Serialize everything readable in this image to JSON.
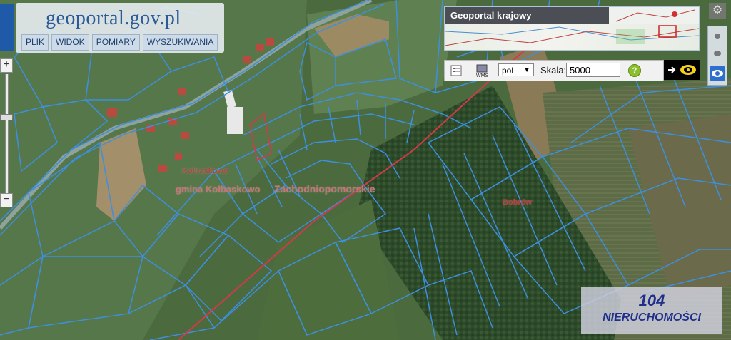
{
  "header": {
    "logo_text": "geoportal.gov.pl"
  },
  "menu": [
    {
      "label": "PLIK"
    },
    {
      "label": "WIDOK"
    },
    {
      "label": "POMIARY"
    },
    {
      "label": "WYSZUKIWANIA"
    }
  ],
  "zoom": {
    "in_symbol": "+",
    "out_symbol": "−",
    "level_fraction": 0.35
  },
  "overview": {
    "title": "Geoportal krajowy"
  },
  "toolbar": {
    "language_value": "pol",
    "scale_label": "Skala:",
    "scale_value": "5000",
    "help_symbol": "?",
    "icons": [
      "legend-icon",
      "wms-icon",
      "help-icon"
    ]
  },
  "map_labels": {
    "gmina": "gmina Kołbaskowo",
    "region": "Zachodniopomorskie",
    "place_1": "Kolbaskowo",
    "place_2": "Bobrów"
  },
  "watermark": {
    "number": "104",
    "name": "NIERUCHOMOŚCI"
  },
  "colors": {
    "parcel_lines": "#3d8fe0",
    "admin_boundary": "#d23a4a",
    "panel_bg": "#e8eef4"
  }
}
